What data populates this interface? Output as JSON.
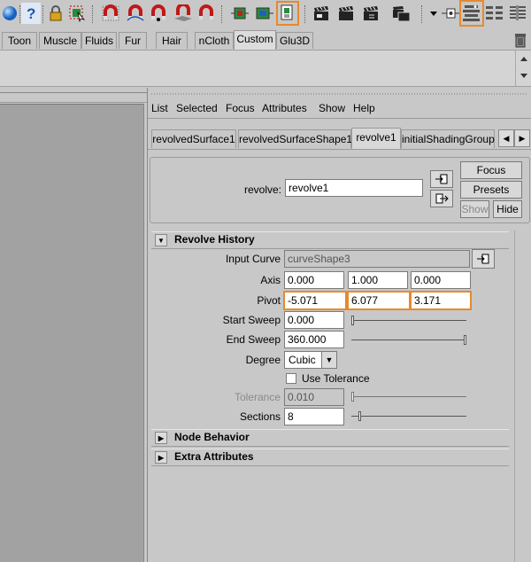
{
  "colors": {
    "highlight": "#e8892c",
    "viewport": "#a2a2a2",
    "panel": "#c8c8c8"
  },
  "toolbar": {
    "icons": [
      "sphere-icon",
      "help-icon",
      "lock-icon",
      "select-icon",
      "magnet-icon",
      "magnet-curve-icon",
      "magnet-point-icon",
      "magnet-plane-icon",
      "magnet-live-icon",
      "render-region-icon",
      "render-icon",
      "snapshot-icon",
      "clapper-icon",
      "clapper-ipr-icon",
      "clapper-settings-icon",
      "clapper-batch-icon",
      "dropdown-icon",
      "input-ops-icon",
      "attribute-editor-icon",
      "channel-box-icon"
    ],
    "highlighted": "attribute-editor-icon"
  },
  "shelf": {
    "tabs": [
      "Toon",
      "Muscle",
      "Fluids",
      "Fur",
      "Hair",
      "nCloth",
      "Custom",
      "Glu3D"
    ],
    "active": "Custom"
  },
  "ae": {
    "menu": [
      "List",
      "Selected",
      "Focus",
      "Attributes",
      "Show",
      "Help"
    ],
    "node_tabs": [
      "revolvedSurface1",
      "revolvedSurfaceShape1",
      "revolve1",
      "initialShadingGroup"
    ],
    "active_tab": "revolve1",
    "node_label": "revolve:",
    "node_value": "revolve1",
    "buttons": {
      "focus": "Focus",
      "presets": "Presets",
      "show": "Show",
      "hide": "Hide"
    },
    "sections": {
      "revolve_history": "Revolve History",
      "node_behavior": "Node Behavior",
      "extra_attributes": "Extra Attributes"
    },
    "attrs": {
      "input_curve": {
        "label": "Input Curve",
        "value": "curveShape3"
      },
      "axis": {
        "label": "Axis",
        "values": [
          "0.000",
          "1.000",
          "0.000"
        ]
      },
      "pivot": {
        "label": "Pivot",
        "values": [
          "-5.071",
          "6.077",
          "3.171"
        ]
      },
      "start_sweep": {
        "label": "Start Sweep",
        "value": "0.000",
        "slider_fraction": 0.0
      },
      "end_sweep": {
        "label": "End Sweep",
        "value": "360.000",
        "slider_fraction": 1.0
      },
      "degree": {
        "label": "Degree",
        "value": "Cubic"
      },
      "use_tolerance": {
        "label": "Use Tolerance",
        "checked": false
      },
      "tolerance": {
        "label": "Tolerance",
        "value": "0.010",
        "slider_fraction": 0.0
      },
      "sections": {
        "label": "Sections",
        "value": "8",
        "slider_fraction": 0.06
      }
    }
  }
}
